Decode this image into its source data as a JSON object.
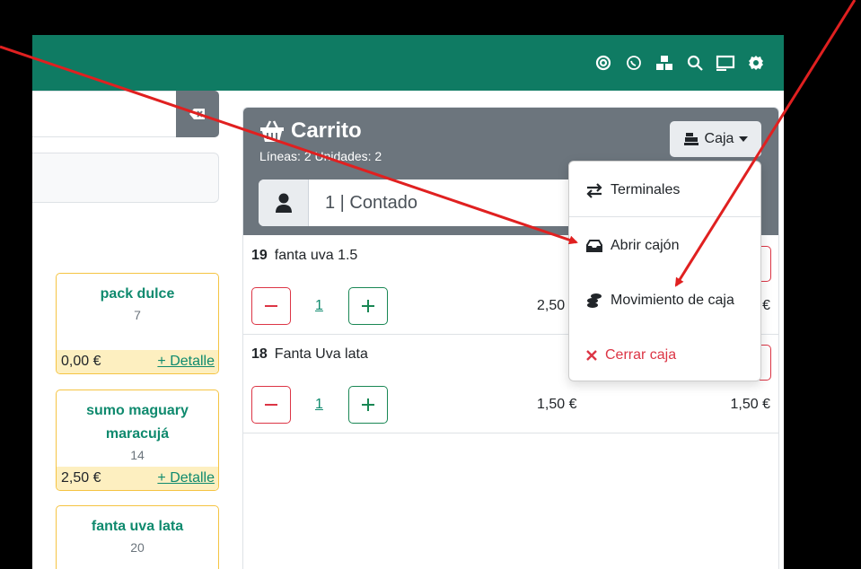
{
  "header": {
    "icons": [
      "lifebuoy-icon",
      "whatsapp-icon",
      "cubes-icon",
      "search-icon",
      "cash-register-icon",
      "gear-icon"
    ]
  },
  "products": [
    {
      "name": "pack dulce",
      "code": "7",
      "price": "0,00 €",
      "detail": "+ Detalle"
    },
    {
      "name": "sumo maguary maracujá",
      "code": "14",
      "price": "2,50 €",
      "detail": "+ Detalle"
    },
    {
      "name": "fanta uva lata",
      "code": "20"
    }
  ],
  "cart": {
    "title": "Carrito",
    "summary": "Líneas: 2 Unidades: 2",
    "caja_label": "Caja",
    "customer": "1 | Contado",
    "lines": [
      {
        "id": "19",
        "name": "fanta uva 1.5",
        "qty": "1",
        "unit_price": "2,50",
        "total": "€"
      },
      {
        "id": "18",
        "name": "Fanta Uva lata",
        "qty": "1",
        "unit_price": "1,50 €",
        "total": "1,50 €"
      }
    ]
  },
  "menu": {
    "terminales": "Terminales",
    "abrir": "Abrir cajón",
    "movimiento": "Movimiento de caja",
    "cerrar": "Cerrar caja"
  },
  "colors": {
    "primary": "#0f7b63",
    "danger": "#dc3545",
    "annotation": "#e02020"
  }
}
